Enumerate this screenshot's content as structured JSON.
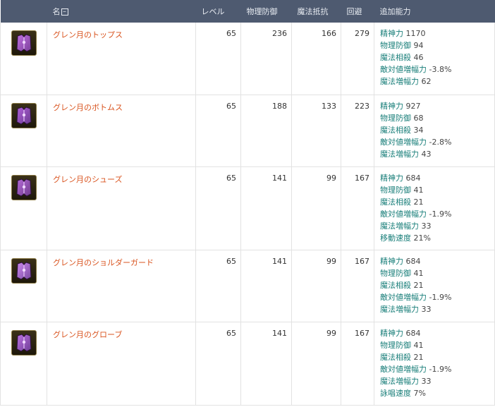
{
  "header": {
    "name": "名",
    "collapse": "–",
    "level": "レベル",
    "phys_def": "物理防御",
    "magic_res": "魔法抵抗",
    "evasion": "回避",
    "extra": "追加能力"
  },
  "rows": [
    {
      "icon": "purple-armor-top-icon",
      "name": "グレン月のトップス",
      "level": "65",
      "phys_def": "236",
      "magic_res": "166",
      "evasion": "279",
      "stats": [
        {
          "label": "精神力",
          "value": "1170"
        },
        {
          "label": "物理防御",
          "value": "94"
        },
        {
          "label": "魔法相殺",
          "value": "46"
        },
        {
          "label": "敵対値増幅力",
          "value": "-3.8%"
        },
        {
          "label": "魔法増幅力",
          "value": "62"
        }
      ]
    },
    {
      "icon": "purple-pants-icon",
      "name": "グレン月のボトムス",
      "level": "65",
      "phys_def": "188",
      "magic_res": "133",
      "evasion": "223",
      "stats": [
        {
          "label": "精神力",
          "value": "927"
        },
        {
          "label": "物理防御",
          "value": "68"
        },
        {
          "label": "魔法相殺",
          "value": "34"
        },
        {
          "label": "敵対値増幅力",
          "value": "-2.8%"
        },
        {
          "label": "魔法増幅力",
          "value": "43"
        }
      ]
    },
    {
      "icon": "purple-boots-icon",
      "name": "グレン月のシューズ",
      "level": "65",
      "phys_def": "141",
      "magic_res": "99",
      "evasion": "167",
      "stats": [
        {
          "label": "精神力",
          "value": "684"
        },
        {
          "label": "物理防御",
          "value": "41"
        },
        {
          "label": "魔法相殺",
          "value": "21"
        },
        {
          "label": "敵対値増幅力",
          "value": "-1.9%"
        },
        {
          "label": "魔法増幅力",
          "value": "33"
        },
        {
          "label": "移動速度",
          "value": "21%"
        }
      ]
    },
    {
      "icon": "purple-shoulder-guard-icon",
      "name": "グレン月のショルダーガード",
      "level": "65",
      "phys_def": "141",
      "magic_res": "99",
      "evasion": "167",
      "stats": [
        {
          "label": "精神力",
          "value": "684"
        },
        {
          "label": "物理防御",
          "value": "41"
        },
        {
          "label": "魔法相殺",
          "value": "21"
        },
        {
          "label": "敵対値増幅力",
          "value": "-1.9%"
        },
        {
          "label": "魔法増幅力",
          "value": "33"
        }
      ]
    },
    {
      "icon": "purple-gloves-icon",
      "name": "グレン月のグローブ",
      "level": "65",
      "phys_def": "141",
      "magic_res": "99",
      "evasion": "167",
      "stats": [
        {
          "label": "精神力",
          "value": "684"
        },
        {
          "label": "物理防御",
          "value": "41"
        },
        {
          "label": "魔法相殺",
          "value": "21"
        },
        {
          "label": "敵対値増幅力",
          "value": "-1.9%"
        },
        {
          "label": "魔法増幅力",
          "value": "33"
        },
        {
          "label": "詠唱速度",
          "value": "7%"
        }
      ]
    }
  ],
  "colors": {
    "header_bg": "#4e5a70",
    "item_name": "#d9531e",
    "stat_label": "#1a7f7a"
  }
}
